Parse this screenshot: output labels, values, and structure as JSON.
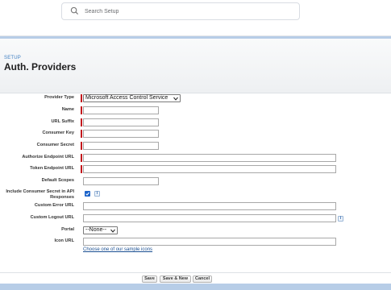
{
  "search": {
    "placeholder": "Search Setup"
  },
  "header": {
    "breadcrumb": "SETUP",
    "title": "Auth. Providers"
  },
  "form": {
    "provider_type": {
      "label": "Provider Type",
      "value": "Microsoft Access Control Service"
    },
    "name": {
      "label": "Name",
      "value": ""
    },
    "url_suffix": {
      "label": "URL Suffix",
      "value": ""
    },
    "consumer_key": {
      "label": "Consumer Key",
      "value": ""
    },
    "consumer_secret": {
      "label": "Consumer Secret",
      "value": ""
    },
    "authorize_endpoint": {
      "label": "Authorize Endpoint URL",
      "value": ""
    },
    "token_endpoint": {
      "label": "Token Endpoint URL",
      "value": ""
    },
    "default_scopes": {
      "label": "Default Scopes",
      "value": ""
    },
    "include_secret": {
      "label_line1": "Include Consumer Secret in API",
      "label_line2": "Responses",
      "checked": true
    },
    "custom_error_url": {
      "label": "Custom Error URL",
      "value": ""
    },
    "custom_logout_url": {
      "label": "Custom Logout URL",
      "value": ""
    },
    "portal": {
      "label": "Portal",
      "value": "--None--"
    },
    "icon_url": {
      "label": "Icon URL",
      "value": ""
    },
    "sample_icons_link": "Choose one of our sample icons",
    "info_glyph": "i"
  },
  "buttons": {
    "save": "Save",
    "save_new": "Save & New",
    "cancel": "Cancel"
  },
  "colors": {
    "required": "#c4171c",
    "link": "#1a4f92",
    "checkbox": "#1b63c9",
    "band": "#b7cde7"
  },
  "icons": {
    "search": "search-icon",
    "info": "info-icon",
    "checkbox": "checkbox-checked-icon"
  }
}
